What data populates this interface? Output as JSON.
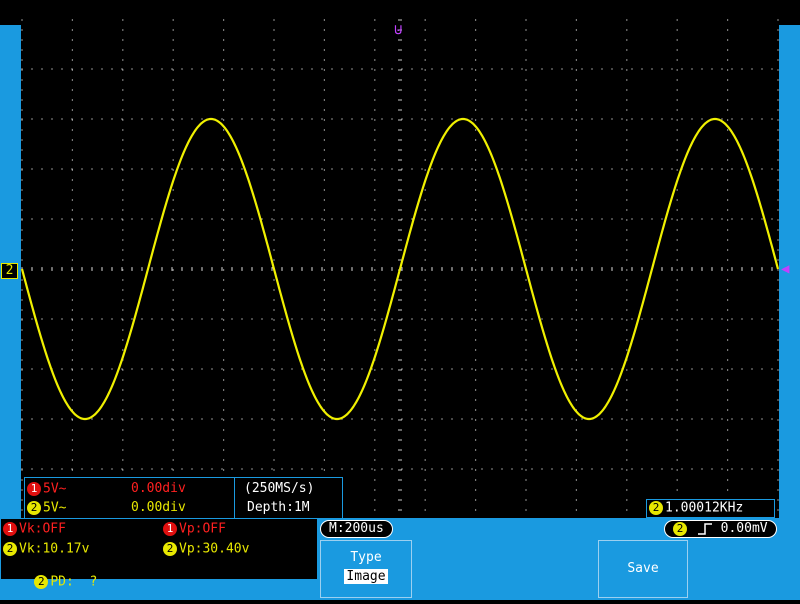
{
  "waveform": {
    "frequency_label": "1.00012KHz",
    "cycles_on_screen": 3,
    "amplitude_div": 3,
    "color": "#f0f000"
  },
  "markers": {
    "channel_marker": "2",
    "trigger_marker": "◀",
    "trigger_top_marker": "⊍"
  },
  "channel_info": {
    "ch1": {
      "num": "1",
      "scale": "5V~",
      "offset": "0.00div"
    },
    "ch2": {
      "num": "2",
      "scale": "5V~",
      "offset": "0.00div"
    },
    "sample_rate": "(250MS/s)",
    "depth": "Depth:1M"
  },
  "freq_readout": {
    "num": "2",
    "value": "1.00012KHz"
  },
  "measurements": {
    "row1": [
      {
        "num": "1",
        "text": "Vk:OFF"
      },
      {
        "num": "1",
        "text": "Vp:OFF"
      }
    ],
    "row2": [
      {
        "num": "2",
        "text": "Vk:10.17v"
      },
      {
        "num": "2",
        "text": "Vp:30.40v"
      }
    ],
    "row3": {
      "num": "2",
      "text": "PD:  ?"
    }
  },
  "timebase": "M:200us",
  "trigger": {
    "num": "2",
    "edge_icon": "rising-edge-icon",
    "level": "0.00mV"
  },
  "menu": {
    "type_label": "Type",
    "type_value": "Image",
    "save_label": "Save"
  },
  "colors": {
    "accent": "#1a9ae0",
    "trace": "#f0f000",
    "red_text": "#ff2020",
    "yellow_text": "#e8e800",
    "trigger_marker": "#c040ff"
  }
}
